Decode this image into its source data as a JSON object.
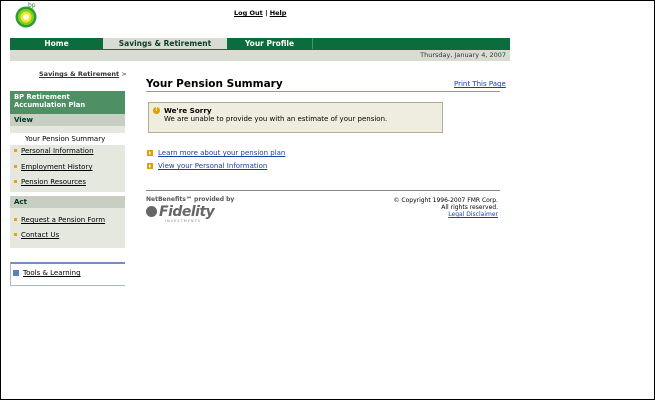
{
  "header": {
    "logo_text": "bp",
    "logout_label": "Log Out",
    "separator": "|",
    "help_label": "Help"
  },
  "nav": {
    "tabs": [
      {
        "label": "Home"
      },
      {
        "label": "Savings & Retirement"
      },
      {
        "label": "Your Profile"
      }
    ],
    "active_index": 1,
    "date": "Thursday, January 4, 2007"
  },
  "breadcrumb": {
    "link": "Savings & Retirement",
    "separator": ">"
  },
  "sidebar": {
    "plan_title_line1": "BP Retirement",
    "plan_title_line2": "Accumulation Plan",
    "view_section": "View",
    "view_items": [
      {
        "label": "Your Pension Summary",
        "current": true
      },
      {
        "label": "Personal Information"
      },
      {
        "label": "Employment History"
      },
      {
        "label": "Pension Resources"
      }
    ],
    "act_section": "Act",
    "act_items": [
      {
        "label": "Request a Pension Form"
      },
      {
        "label": "Contact Us"
      }
    ],
    "tools_label": "Tools & Learning"
  },
  "main": {
    "title": "Your Pension Summary",
    "print_label": "Print This Page",
    "alert": {
      "title": "We're Sorry",
      "message": "We are unable to provide you with an estimate of your pension."
    },
    "links": [
      {
        "label": "Learn more about your pension plan"
      },
      {
        "label": "View your Personal Information"
      }
    ]
  },
  "footer": {
    "provided_by": "NetBenefits℠ provided by",
    "brand": "Fidelity",
    "brand_sub": "INVESTMENTS",
    "copyright_line1": "© Copyright 1996-2007 FMR Corp.",
    "copyright_line2": "All rights reserved.",
    "legal_label": "Legal Disclaimer"
  },
  "colors": {
    "nav_green": "#0b6d3c",
    "accent_orange": "#e79b00",
    "link_blue": "#1a3fa8"
  }
}
